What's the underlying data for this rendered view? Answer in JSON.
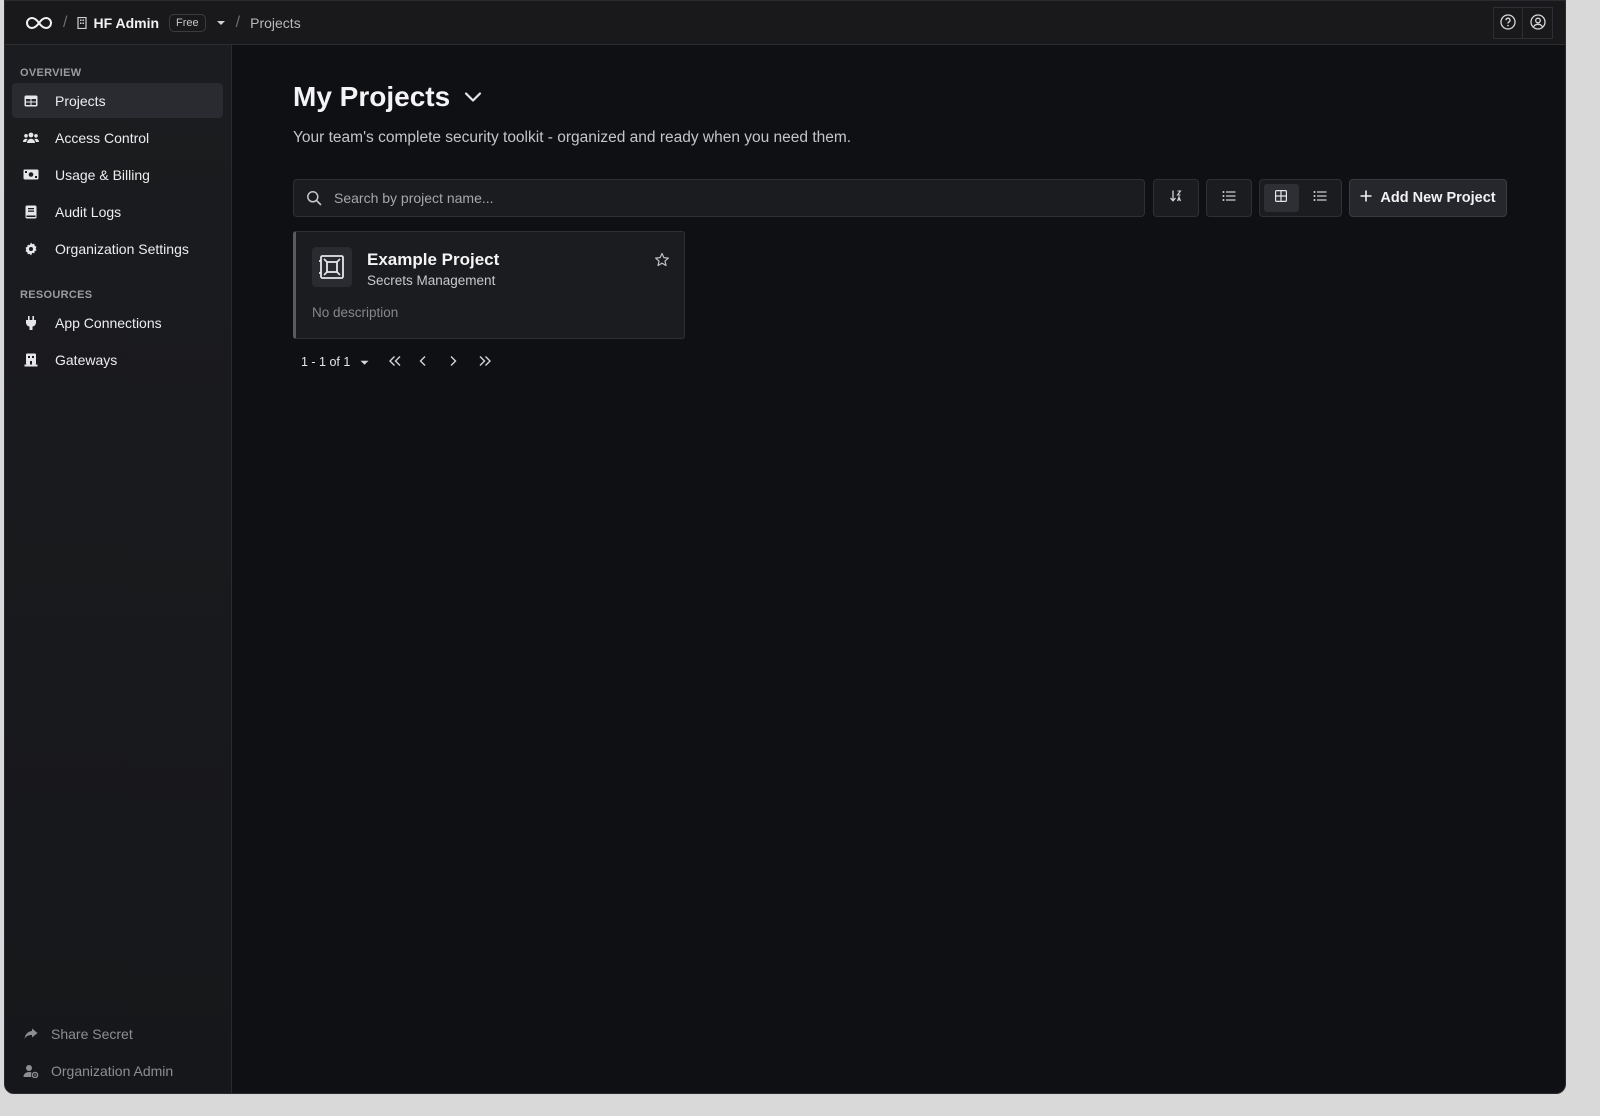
{
  "topbar": {
    "logo_icon": "infinity-icon",
    "org_name": "HF Admin",
    "plan_badge": "Free",
    "breadcrumb_page": "Projects",
    "help_icon": "help-circle-icon",
    "account_icon": "user-circle-icon"
  },
  "sidebar": {
    "overview_title": "OVERVIEW",
    "overview_items": [
      {
        "label": "Projects",
        "icon": "table-icon",
        "active": true
      },
      {
        "label": "Access Control",
        "icon": "users-icon"
      },
      {
        "label": "Usage & Billing",
        "icon": "money-bill-icon"
      },
      {
        "label": "Audit Logs",
        "icon": "book-icon"
      },
      {
        "label": "Organization Settings",
        "icon": "gear-icon"
      }
    ],
    "resources_title": "RESOURCES",
    "resource_items": [
      {
        "label": "App Connections",
        "icon": "plug-icon"
      },
      {
        "label": "Gateways",
        "icon": "building-icon"
      }
    ],
    "bottom_items": [
      {
        "label": "Share Secret",
        "icon": "share-icon"
      },
      {
        "label": "Organization Admin",
        "icon": "user-gear-icon"
      }
    ]
  },
  "main": {
    "title": "My Projects",
    "subtitle": "Your team's complete security toolkit - organized and ready when you need them.",
    "search_placeholder": "Search by project name...",
    "add_button_label": "Add New Project",
    "view_mode": "grid",
    "projects": [
      {
        "name": "Example Project",
        "type": "Secrets Management",
        "description": "No description",
        "icon": "vault-icon"
      }
    ],
    "pagination": {
      "range": "1 - 1 of 1"
    }
  },
  "colors": {
    "background": "#0f1014",
    "sidebar": "#1b1c1f",
    "accent_active": "#2a2b30"
  }
}
